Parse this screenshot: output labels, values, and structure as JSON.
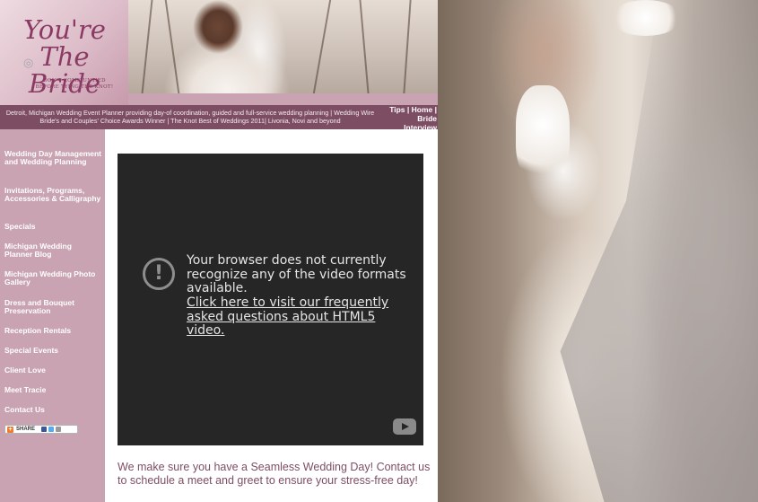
{
  "logo": {
    "title": "You're The Bride",
    "tagline": "DON'T COME UNTIED BEFORE TYING THE KNOT!"
  },
  "topbar": {
    "description": "Detroit, Michigan Wedding Event Planner providing day-of coordination, guided and full-service wedding planning | Wedding Wire Bride's and Couples' Choice Awards Winner | The Knot Best of Weddings 2011| Livonia, Novi and beyond",
    "links": [
      "Tips",
      "Home",
      "Bride",
      "Interview"
    ]
  },
  "sidebar": {
    "items": [
      {
        "label": "Wedding Day Management and Wedding Planning"
      },
      {
        "label": "Invitations, Programs, Accessories & Calligraphy"
      },
      {
        "label": "Specials"
      },
      {
        "label": "Michigan Wedding Planner Blog"
      },
      {
        "label": "Michigan Wedding Photo Gallery"
      },
      {
        "label": "Dress and Bouquet Preservation"
      },
      {
        "label": "Reception Rentals"
      },
      {
        "label": "Special Events"
      },
      {
        "label": "Client Love"
      },
      {
        "label": "Meet Tracie"
      },
      {
        "label": "Contact Us"
      }
    ],
    "share_label": "SHARE"
  },
  "video": {
    "message": "Your browser does not currently recognize any of the video formats available.",
    "link_text": "Click here to visit our frequently asked questions about HTML5 video."
  },
  "content": {
    "tagline": "We make sure you have a Seamless Wedding Day! Contact us to schedule a meet and greet to ensure your stress-free day!"
  },
  "colors": {
    "sidebar_bg": "#c9a3b1",
    "topbar_bg": "#7d4e63",
    "accent_text": "#7d4e63",
    "video_bg": "#262626"
  }
}
